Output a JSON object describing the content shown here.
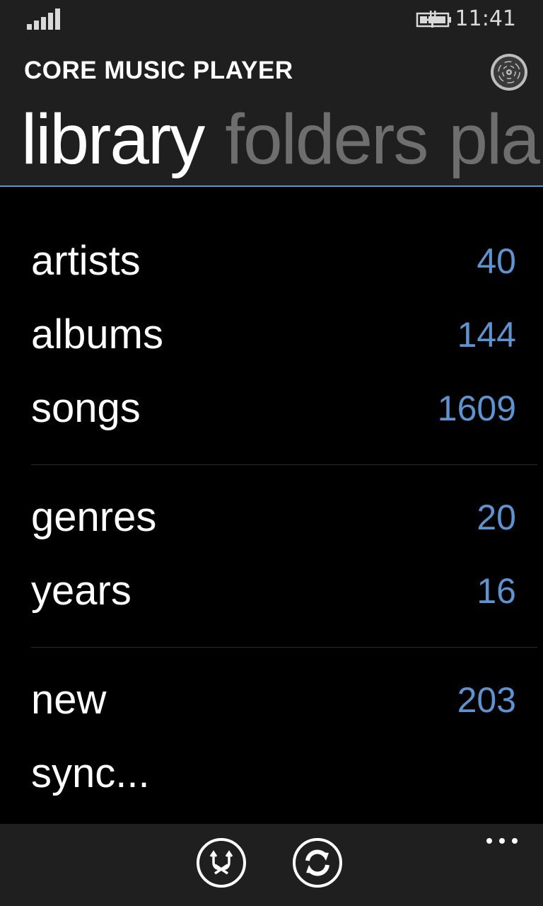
{
  "status_bar": {
    "time": "11:41",
    "signal_icon": "signal-strength-icon",
    "battery_icon": "battery-charging-icon"
  },
  "header": {
    "app_title": "CORE MUSIC PLAYER",
    "disc_icon": "disc-icon",
    "pivot": [
      {
        "label": "library",
        "active": true
      },
      {
        "label": "folders",
        "active": false
      },
      {
        "label": "pla",
        "active": false
      }
    ]
  },
  "library": {
    "groups": [
      [
        {
          "label": "artists",
          "count": "40"
        },
        {
          "label": "albums",
          "count": "144"
        },
        {
          "label": "songs",
          "count": "1609"
        }
      ],
      [
        {
          "label": "genres",
          "count": "20"
        },
        {
          "label": "years",
          "count": "16"
        }
      ],
      [
        {
          "label": "new",
          "count": "203"
        },
        {
          "label": "sync...",
          "count": ""
        }
      ]
    ]
  },
  "app_bar": {
    "buttons": [
      {
        "icon": "shuffle-icon"
      },
      {
        "icon": "refresh-icon"
      }
    ],
    "more_icon": "more-options-icon"
  },
  "colors": {
    "accent": "#5f93cf",
    "chrome": "#1f1f1f",
    "background": "#000000",
    "inactive_pivot": "#6e6e6e"
  }
}
